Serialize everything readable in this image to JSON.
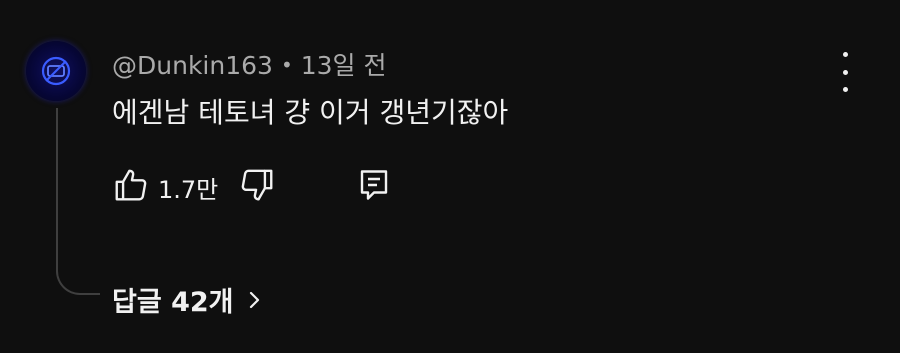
{
  "comment": {
    "author": "@Dunkin163",
    "time": "13일 전",
    "text": "에겐남 테토녀 걍 이거 갱년기잖아",
    "likes": "1.7만",
    "replies_label": "답글 42개"
  },
  "icons": {
    "more": "more-vert-icon",
    "like": "thumbs-up-icon",
    "dislike": "thumbs-down-icon",
    "reply": "reply-icon",
    "expand": "chevron-right-icon"
  },
  "colors": {
    "background": "#0f0f0f",
    "text": "#f1f1f1",
    "meta": "#aaaaaa",
    "thread_line": "#3f3f3f",
    "avatar_glow": "#2a2ad0"
  }
}
